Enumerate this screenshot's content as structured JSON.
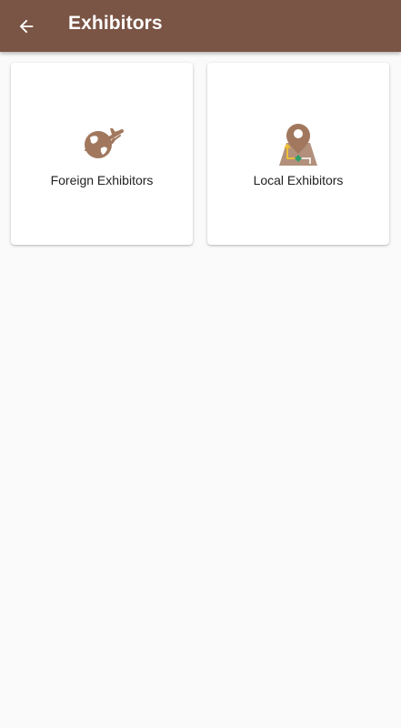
{
  "app_bar": {
    "title": "Exhibitors",
    "back_icon": "arrow-left-icon",
    "background_color": "#7a5444",
    "text_color": "#ffffff"
  },
  "cards": [
    {
      "label": "Foreign Exhibitors",
      "icon": "globe-airplane-icon"
    },
    {
      "label": "Local Exhibitors",
      "icon": "map-pin-icon"
    }
  ],
  "theme": {
    "accent_color": "#a1785e",
    "page_background": "#fafafa",
    "card_background": "#ffffff"
  }
}
